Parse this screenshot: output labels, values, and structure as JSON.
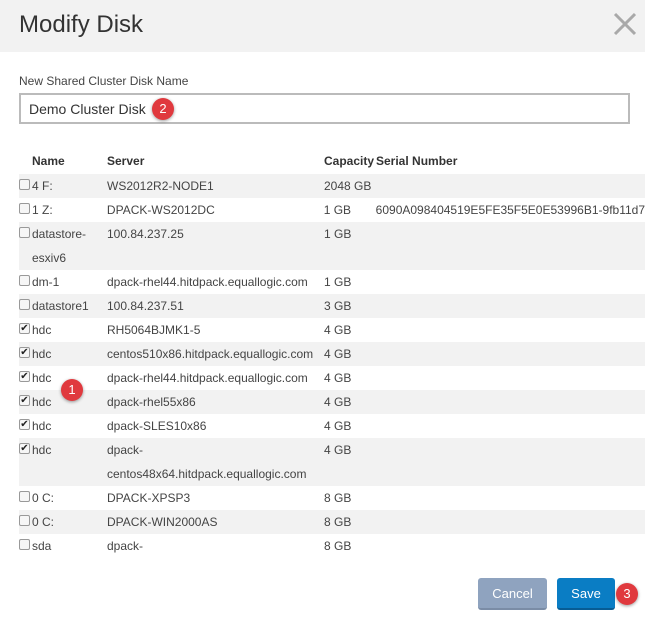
{
  "dialog": {
    "title": "Modify Disk",
    "close_icon": "close-icon"
  },
  "name_field": {
    "label": "New Shared Cluster Disk Name",
    "value": "Demo Cluster Disk"
  },
  "table": {
    "headers": {
      "name": "Name",
      "server": "Server",
      "capacity": "Capacity",
      "serial": "Serial Number"
    },
    "rows": [
      {
        "checked": false,
        "name": "4 F:",
        "server": "WS2012R2-NODE1",
        "capacity": "2048 GB",
        "serial": ""
      },
      {
        "checked": false,
        "name": "1 Z:",
        "server": "DPACK-WS2012DC",
        "capacity": "1 GB",
        "serial": "6090A098404519E5FE35F5E0E53996B1-9fb11d7"
      },
      {
        "checked": false,
        "name": "datastore-esxiv6",
        "server": "100.84.237.25",
        "capacity": "1 GB",
        "serial": ""
      },
      {
        "checked": false,
        "name": "dm-1",
        "server": "dpack-rhel44.hitdpack.equallogic.com",
        "capacity": "1 GB",
        "serial": ""
      },
      {
        "checked": false,
        "name": "datastore1",
        "server": "100.84.237.51",
        "capacity": "3 GB",
        "serial": ""
      },
      {
        "checked": true,
        "name": "hdc",
        "server": "RH5064BJMK1-5",
        "capacity": "4 GB",
        "serial": ""
      },
      {
        "checked": true,
        "name": "hdc",
        "server": "centos510x86.hitdpack.equallogic.com",
        "capacity": "4 GB",
        "serial": ""
      },
      {
        "checked": true,
        "name": "hdc",
        "server": "dpack-rhel44.hitdpack.equallogic.com",
        "capacity": "4 GB",
        "serial": ""
      },
      {
        "checked": true,
        "name": "hdc",
        "server": "dpack-rhel55x86",
        "capacity": "4 GB",
        "serial": ""
      },
      {
        "checked": true,
        "name": "hdc",
        "server": "dpack-SLES10x86",
        "capacity": "4 GB",
        "serial": ""
      },
      {
        "checked": true,
        "name": "hdc",
        "server": "dpack-centos48x64.hitdpack.equallogic.com",
        "capacity": "4 GB",
        "serial": ""
      },
      {
        "checked": false,
        "name": "0 C:",
        "server": "DPACK-XPSP3",
        "capacity": "8 GB",
        "serial": ""
      },
      {
        "checked": false,
        "name": "0 C:",
        "server": "DPACK-WIN2000AS",
        "capacity": "8 GB",
        "serial": ""
      },
      {
        "checked": false,
        "name": "sda",
        "server": "dpack-",
        "capacity": "8 GB",
        "serial": ""
      }
    ]
  },
  "buttons": {
    "cancel": "Cancel",
    "save": "Save"
  },
  "callouts": {
    "one": "1",
    "two": "2",
    "three": "3"
  },
  "colors": {
    "callout": "#e0393e",
    "save": "#0a7dc4",
    "cancel": "#8fa3bf",
    "stripe": "#f2f2f2"
  }
}
